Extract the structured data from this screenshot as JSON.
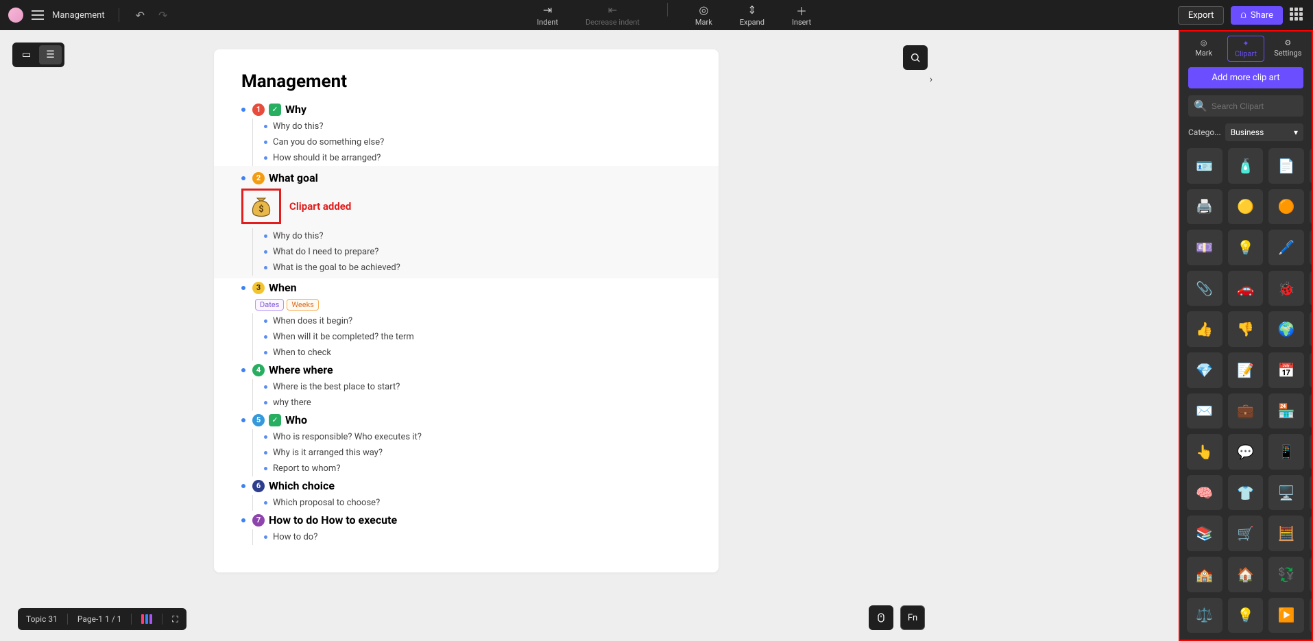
{
  "header": {
    "doc_title": "Management",
    "toolbar": {
      "indent": "Indent",
      "decrease_indent": "Decrease indent",
      "mark": "Mark",
      "expand": "Expand",
      "insert": "Insert"
    },
    "export": "Export",
    "share": "Share"
  },
  "document": {
    "title": "Management",
    "clipart_added": "Clipart added",
    "sections": [
      {
        "num": "1",
        "badge": "nb-red",
        "check": true,
        "label": "Why",
        "subs": [
          "Why do this?",
          "Can you do something else?",
          "How should it be arranged?"
        ]
      },
      {
        "num": "2",
        "badge": "nb-orange",
        "label": "What goal",
        "clipart": true,
        "subs": [
          "Why do this?",
          "What do I need to prepare?",
          "What is the goal to be achieved?"
        ]
      },
      {
        "num": "3",
        "badge": "nb-yellow",
        "label": "When",
        "pills": [
          {
            "text": "Dates",
            "cls": "pill-purple"
          },
          {
            "text": "Weeks",
            "cls": "pill-orange"
          }
        ],
        "subs": [
          "When does it begin?",
          "When will it be completed? the term",
          "When to check"
        ]
      },
      {
        "num": "4",
        "badge": "nb-green",
        "label": "Where where",
        "subs": [
          "Where is the best place to start?",
          "why there"
        ]
      },
      {
        "num": "5",
        "badge": "nb-blue",
        "check": true,
        "label": "Who",
        "subs": [
          "Who is responsible? Who executes it?",
          "Why is it arranged this way?",
          "Report to whom?"
        ]
      },
      {
        "num": "6",
        "badge": "nb-dblue",
        "label": "Which choice",
        "subs": [
          "Which proposal to choose?"
        ]
      },
      {
        "num": "7",
        "badge": "nb-purple",
        "label": "How to do How to execute",
        "subs": [
          "How to do?"
        ]
      }
    ]
  },
  "panel": {
    "tabs": {
      "mark": "Mark",
      "clipart": "Clipart",
      "settings": "Settings"
    },
    "add_button": "Add more clip art",
    "search_placeholder": "Search Clipart",
    "category_label": "Catego...",
    "category_selected": "Business",
    "cliparts": [
      "🪪",
      "🧴",
      "📄",
      "🖃",
      "🖨️",
      "🟡",
      "🟠",
      "💰",
      "💷",
      "💡",
      "🖊️",
      "📎",
      "📎",
      "🚗",
      "🐞",
      "🌐",
      "👍",
      "👎",
      "🌍",
      "🖱️",
      "💎",
      "📝",
      "📅",
      "✉️",
      "✉️",
      "💼",
      "🏪",
      "🧭",
      "👆",
      "💬",
      "📱",
      "✂️",
      "🧠",
      "👕",
      "🖥️",
      "❤️",
      "📚",
      "🛒",
      "🧮",
      "🏠",
      "🏫",
      "🏠",
      "💱",
      "🪪",
      "⚖️",
      "💡",
      "▶️",
      "📖"
    ]
  },
  "bottombar": {
    "topic": "Topic 31",
    "page": "Page-1  1 / 1"
  },
  "float": {
    "fn": "Fn"
  }
}
